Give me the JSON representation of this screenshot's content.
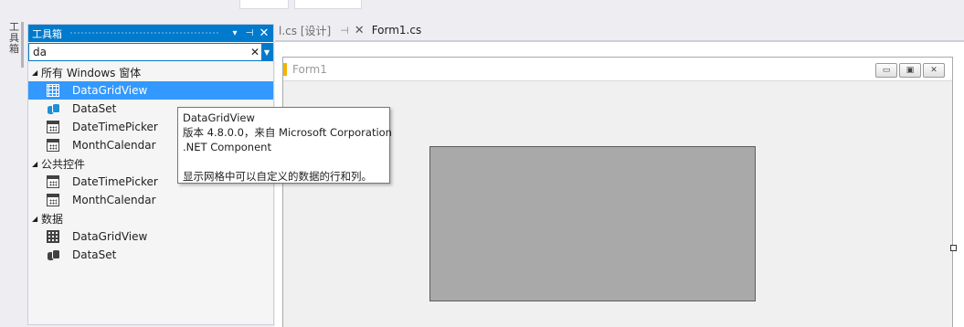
{
  "toolbox": {
    "title": "工具箱",
    "search_value": "da",
    "groups": [
      {
        "label": "所有 Windows 窗体",
        "items": [
          {
            "label": "DataGridView",
            "icon": "datagridview-icon",
            "selected": true
          },
          {
            "label": "DataSet",
            "icon": "dataset-icon"
          },
          {
            "label": "DateTimePicker",
            "icon": "datetimepicker-icon"
          },
          {
            "label": "MonthCalendar",
            "icon": "monthcalendar-icon"
          }
        ]
      },
      {
        "label": "公共控件",
        "items": [
          {
            "label": "DateTimePicker",
            "icon": "datetimepicker-icon"
          },
          {
            "label": "MonthCalendar",
            "icon": "monthcalendar-icon"
          }
        ]
      },
      {
        "label": "数据",
        "items": [
          {
            "label": "DataGridView",
            "icon": "datagridview-icon"
          },
          {
            "label": "DataSet",
            "icon": "dataset-icon"
          }
        ]
      }
    ]
  },
  "left_dock": {
    "tab_label": "工具箱"
  },
  "tabs": [
    {
      "label": "l.cs [设计]",
      "state": "inactive"
    },
    {
      "label": "Form1.cs",
      "state": "active"
    }
  ],
  "form": {
    "title": "Form1"
  },
  "tooltip": {
    "name": "DataGridView",
    "version": "版本 4.8.0.0，来自 Microsoft Corporation",
    "component": ".NET Component",
    "description": "显示网格中可以自定义的数据的行和列。"
  },
  "colors": {
    "accent": "#007acc",
    "selection": "#3399ff",
    "grid_control": "#a9a9a9"
  }
}
